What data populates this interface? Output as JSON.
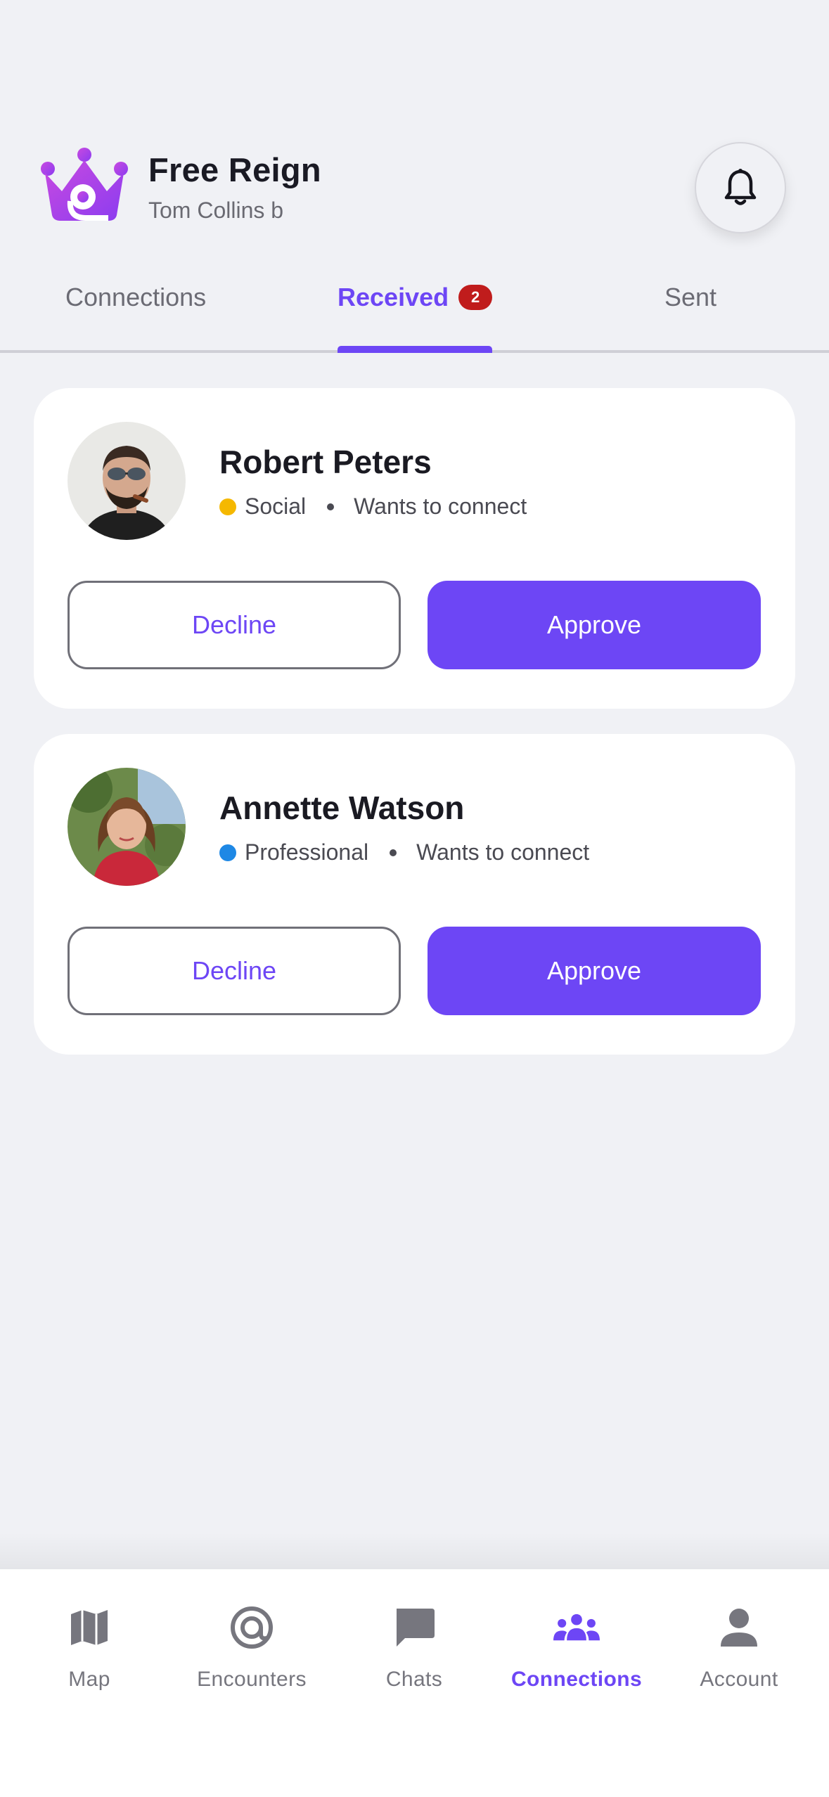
{
  "app": {
    "name": "Free Reign",
    "user": "Tom Collins b"
  },
  "tabs": [
    {
      "label": "Connections",
      "active": false
    },
    {
      "label": "Received",
      "active": true,
      "badge": "2"
    },
    {
      "label": "Sent",
      "active": false
    }
  ],
  "requests": [
    {
      "name": "Robert Peters",
      "category": "Social",
      "category_color": "#f5b800",
      "status": "Wants to connect",
      "decline_label": "Decline",
      "approve_label": "Approve"
    },
    {
      "name": "Annette Watson",
      "category": "Professional",
      "category_color": "#1e88e5",
      "status": "Wants to connect",
      "decline_label": "Decline",
      "approve_label": "Approve"
    }
  ],
  "bottom_nav": [
    {
      "label": "Map",
      "icon": "map-icon",
      "active": false
    },
    {
      "label": "Encounters",
      "icon": "encounters-icon",
      "active": false
    },
    {
      "label": "Chats",
      "icon": "chat-icon",
      "active": false
    },
    {
      "label": "Connections",
      "icon": "people-icon",
      "active": true
    },
    {
      "label": "Account",
      "icon": "person-icon",
      "active": false
    }
  ],
  "colors": {
    "accent": "#6d46f5",
    "badge": "#c01c1c",
    "background": "#f0f1f5"
  }
}
